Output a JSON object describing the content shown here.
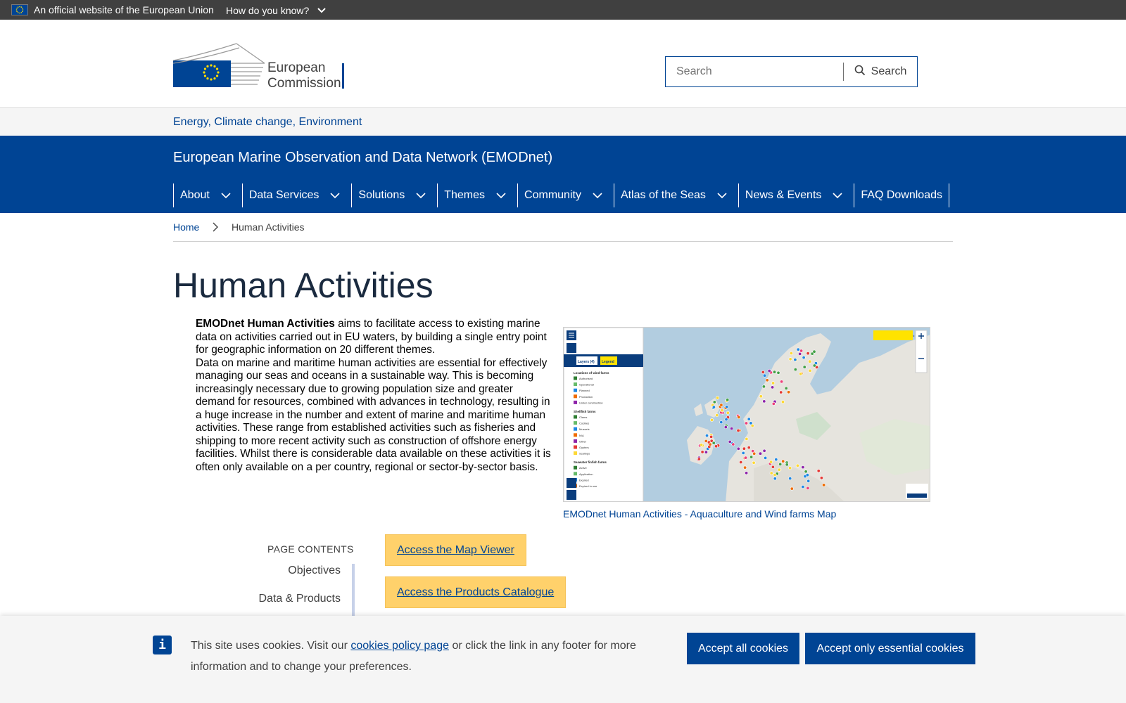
{
  "topbar": {
    "official_text": "An official website of the European Union",
    "how_text": "How do you know?"
  },
  "header": {
    "logo_line1": "European",
    "logo_line2": "Commission",
    "search_placeholder": "Search",
    "search_button": "Search"
  },
  "site_strip": {
    "label": "Energy, Climate change, Environment"
  },
  "site": {
    "name": "European Marine Observation and Data Network (EMODnet)"
  },
  "menu": [
    {
      "label": "About",
      "has_dropdown": true
    },
    {
      "label": "Data Services",
      "has_dropdown": true
    },
    {
      "label": "Solutions",
      "has_dropdown": true
    },
    {
      "label": "Themes",
      "has_dropdown": true
    },
    {
      "label": "Community",
      "has_dropdown": true
    },
    {
      "label": "Atlas of the Seas",
      "has_dropdown": true
    },
    {
      "label": "News & Events",
      "has_dropdown": true
    },
    {
      "label": "FAQ Downloads",
      "has_dropdown": false
    }
  ],
  "breadcrumb": {
    "home": "Home",
    "current": "Human Activities"
  },
  "page": {
    "title": "Human Activities",
    "intro_bold": "EMODnet Human Activities",
    "intro_rest": " aims to facilitate access to existing marine data on activities carried out in EU waters, by building a single entry point for geographic information on 20 different themes.",
    "paragraph2": "Data on marine and maritime human activities are essential for effectively managing our seas and oceans in a sustainable way. This is becoming increasingly necessary due to growing population size and greater demand for resources, combined with advances in technology, resulting in a huge increase in the number and extent of marine and maritime human activities. These range from established activities such as fisheries and shipping to more recent activity such as construction of offshore energy facilities. Whilst there is considerable data available on these activities it is often only available on a per country, regional or sector-by-sector basis.",
    "figure_caption": "EMODnet Human Activities - Aquaculture and Wind farms Map"
  },
  "page_contents": {
    "title": "PAGE CONTENTS",
    "items": [
      "Objectives",
      "Data & Products"
    ]
  },
  "cta": {
    "map_viewer": "Access the Map Viewer ",
    "products_catalogue": "Access the Products Catalogue"
  },
  "cookie": {
    "text_before": "This site uses cookies. Visit our ",
    "link": "cookies policy page",
    "text_after": " or click the link in any footer for more information and to change your preferences.",
    "accept_all": "Accept all cookies",
    "accept_essential": "Accept only essential cookies",
    "info_glyph": "i"
  },
  "map_panel": {
    "layers_tab": "Layers (4)",
    "legend_tab": "Legend",
    "groups": [
      {
        "title": "Locations of wind farms",
        "items": [
          "Authorised",
          "Operational",
          "Planned",
          "Production",
          "Under construction"
        ]
      },
      {
        "title": "Shellfish farms",
        "items": [
          "Clams",
          "Cockles",
          "Mussels",
          "N/A",
          "Other",
          "Oysters",
          "Scallops"
        ]
      },
      {
        "title": "Seawater finfish farms",
        "items": [
          "Active",
          "Application",
          "Expired",
          "Expired in use"
        ]
      }
    ],
    "tooltip": "Click on the map to get feature info",
    "powered": "Powered by",
    "brand": "EMODnet"
  },
  "colors": {
    "eu_blue": "#004494",
    "cta_yellow": "#ffd16b",
    "topbar": "#404040"
  }
}
